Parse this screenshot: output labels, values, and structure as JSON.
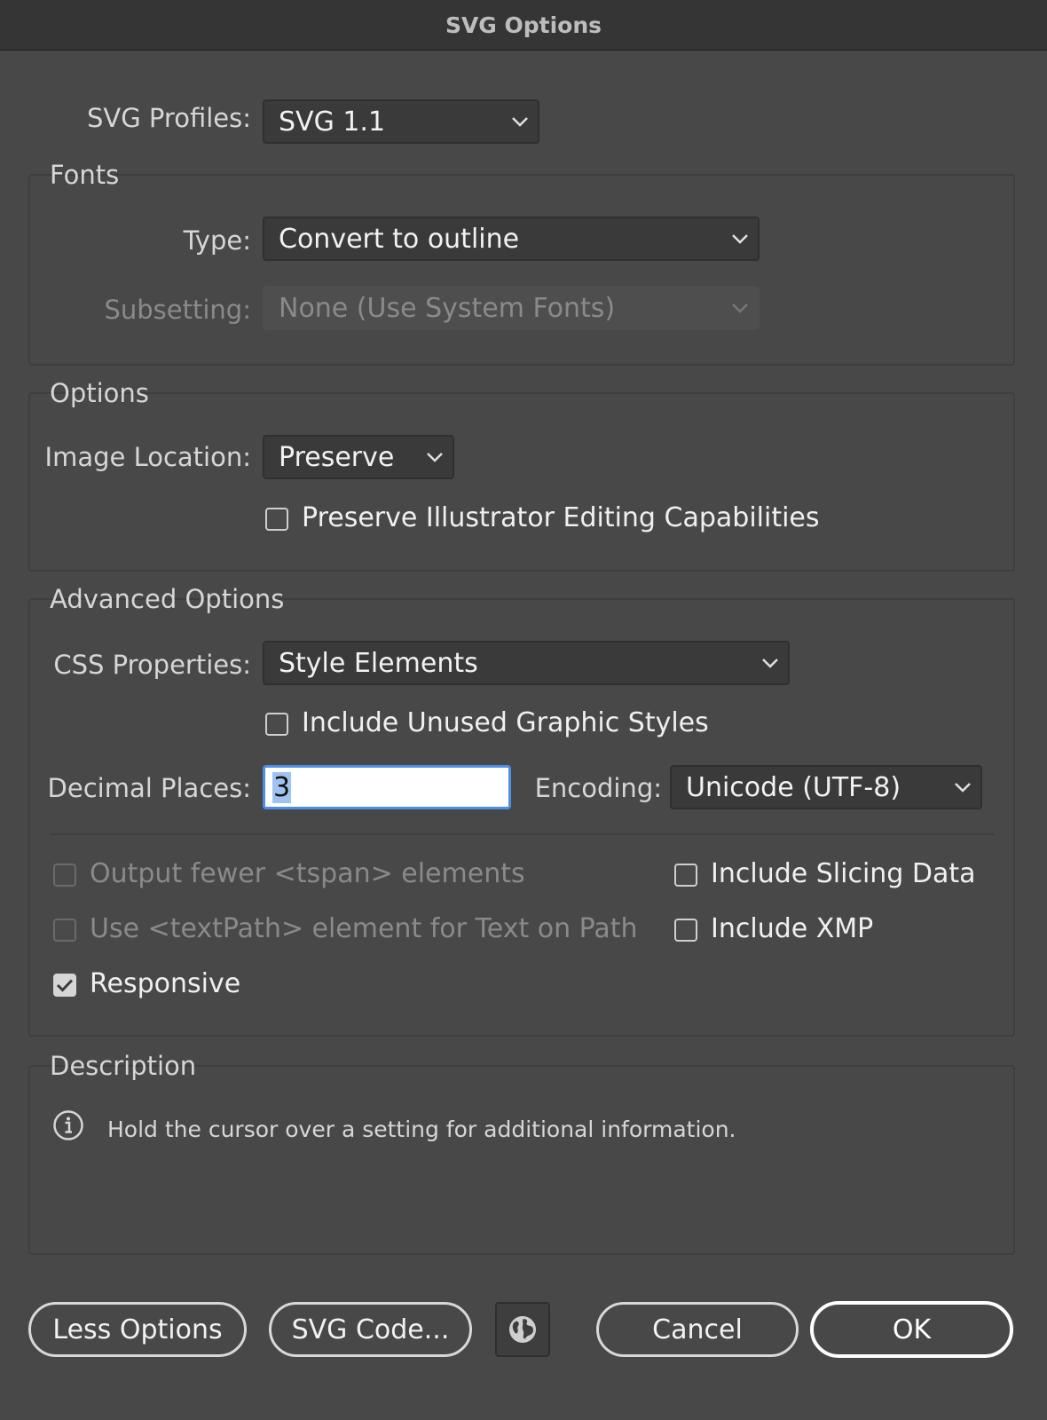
{
  "title": "SVG Options",
  "svg_profiles": {
    "label": "SVG Profiles:",
    "value": "SVG 1.1"
  },
  "fonts": {
    "title": "Fonts",
    "type_label": "Type:",
    "type_value": "Convert to outline",
    "subsetting_label": "Subsetting:",
    "subsetting_value": "None (Use System Fonts)"
  },
  "options": {
    "title": "Options",
    "image_location_label": "Image Location:",
    "image_location_value": "Preserve",
    "preserve_editing_label": "Preserve Illustrator Editing Capabilities",
    "preserve_editing_checked": false
  },
  "advanced": {
    "title": "Advanced Options",
    "css_label": "CSS Properties:",
    "css_value": "Style Elements",
    "unused_styles_label": "Include Unused Graphic Styles",
    "decimal_label": "Decimal Places:",
    "decimal_value": "3",
    "encoding_label": "Encoding:",
    "encoding_value": "Unicode (UTF-8)",
    "tspan_label": "Output fewer <tspan> elements",
    "textpath_label": "Use <textPath> element for Text on Path",
    "responsive_label": "Responsive",
    "responsive_checked": true,
    "slicing_label": "Include Slicing Data",
    "xmp_label": "Include XMP"
  },
  "description": {
    "title": "Description",
    "text": "Hold the cursor over a setting for additional information."
  },
  "buttons": {
    "less_options": "Less Options",
    "svg_code": "SVG Code...",
    "cancel": "Cancel",
    "ok": "OK"
  },
  "icons": {
    "chevron": "chevron-down-icon",
    "info": "info-icon",
    "globe": "globe-icon",
    "check": "check-icon"
  },
  "colors": {
    "background": "#484848",
    "titlebar": "#353535",
    "focus": "#4d8ee6"
  }
}
